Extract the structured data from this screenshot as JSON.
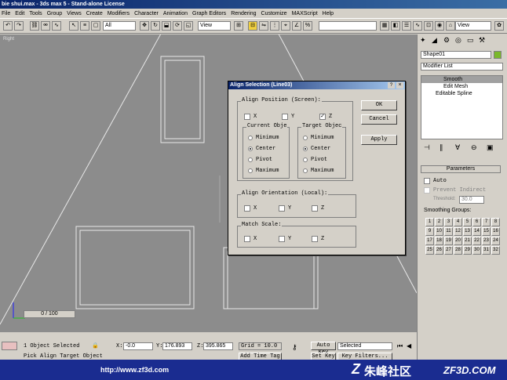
{
  "window": {
    "title": "bie shui.max - 3ds max 5 - Stand-alone License"
  },
  "menu": [
    "File",
    "Edit",
    "Tools",
    "Group",
    "Views",
    "Create",
    "Modifiers",
    "Character",
    "Animation",
    "Graph Editors",
    "Rendering",
    "Customize",
    "MAXScript",
    "Help"
  ],
  "toolbar": {
    "selection_filter": "All",
    "ref_coord": "View",
    "named_sel": "",
    "view_dropdown": "View"
  },
  "viewport": {
    "label": "Right"
  },
  "command_panel": {
    "object_name": "Shape01",
    "modifier_list": "Modifier List",
    "stack": [
      "Smooth",
      "Edit Mesh",
      "Editable Spline"
    ],
    "params_title": "Parameters",
    "auto_label": "Auto",
    "prevent_indirect": "Prevent Indirect",
    "threshold_label": "Threshold:",
    "threshold_value": "30.0",
    "smoothing_groups_label": "Smoothing Groups:",
    "smoothing_groups": [
      "1",
      "2",
      "3",
      "4",
      "5",
      "6",
      "7",
      "8",
      "9",
      "10",
      "11",
      "12",
      "13",
      "14",
      "15",
      "16",
      "17",
      "18",
      "19",
      "20",
      "21",
      "22",
      "23",
      "24",
      "25",
      "26",
      "27",
      "28",
      "29",
      "30",
      "31",
      "32"
    ]
  },
  "dialog": {
    "title": "Align Selection (Line03)",
    "help": "?",
    "close": "×",
    "align_position": "Align Position (Screen):",
    "x": "X",
    "y": "Y",
    "z": "Z",
    "current_object": "Current Obje",
    "target_object": "Target Objec",
    "options": [
      "Minimum",
      "Center",
      "Pivot",
      "Maximum"
    ],
    "align_orientation": "Align Orientation (Local):",
    "match_scale": "Match Scale:",
    "ok": "OK",
    "cancel": "Cancel",
    "apply": "Apply"
  },
  "status": {
    "time_slider": "0 / 100",
    "selected": "1 Object Selected",
    "prompt": "Pick Align Target Object",
    "x_label": "X:",
    "x_value": "-0.0",
    "y_label": "Y:",
    "y_value": "176.893",
    "z_label": "Z:",
    "z_value": "395.865",
    "grid": "Grid = 10.0",
    "add_time_tag": "Add Time Tag",
    "auto_key": "Auto Key",
    "set_key": "Set Key",
    "selected_dropdown": "Selected",
    "key_filters": "Key Filters..."
  },
  "banner": {
    "url": "http://www.zf3d.com",
    "site_name": "朱峰社区",
    "site_domain": "ZF3D.COM"
  }
}
